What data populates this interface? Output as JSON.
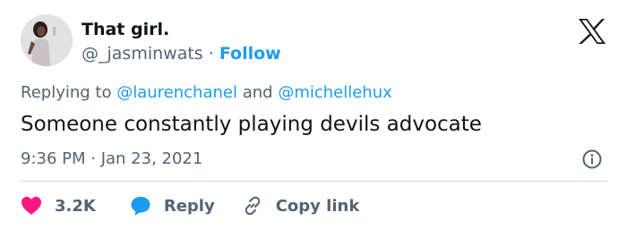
{
  "author": {
    "display_name": "That girl.",
    "handle": "@_jasminwats",
    "separator": "·",
    "follow_label": "Follow"
  },
  "reply_context": {
    "prefix": "Replying to",
    "mentions": [
      "@laurenchanel",
      "@michellehux"
    ],
    "conjunction": "and"
  },
  "tweet": {
    "text": "Someone constantly playing devils advocate",
    "timestamp": "9:36 PM · Jan 23, 2021"
  },
  "actions": {
    "likes_count": "3.2K",
    "reply_label": "Reply",
    "copy_link_label": "Copy link"
  },
  "icons": {
    "brand": "x-logo-icon",
    "info": "info-icon",
    "like": "heart-icon",
    "reply": "speech-bubble-icon",
    "copy_link": "link-icon"
  },
  "colors": {
    "accent": "#1d9bf0",
    "like": "#f91880",
    "text_primary": "#0f1419",
    "text_secondary": "#536471"
  }
}
